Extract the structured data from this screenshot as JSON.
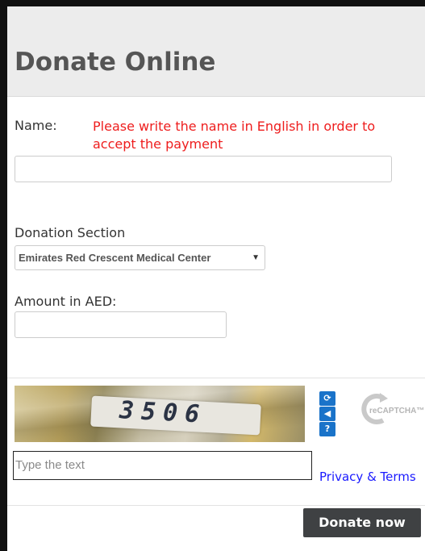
{
  "page": {
    "title": "Donate Online"
  },
  "form": {
    "name_label": "Name:",
    "name_note": "Please write the name in English in order to accept the payment",
    "name_value": "",
    "section_label": "Donation Section",
    "section_selected": "Emirates Red Crescent Medical Center",
    "amount_label": "Amount in AED:",
    "amount_value": ""
  },
  "captcha": {
    "challenge_text": "3506",
    "input_placeholder": "Type the text",
    "privacy_link": "Privacy & Terms",
    "brand": "reCAPTCHA™",
    "buttons": [
      "refresh-icon",
      "audio-icon",
      "help-icon"
    ]
  },
  "actions": {
    "donate_label": "Donate now"
  },
  "colors": {
    "header_bg": "#ececec",
    "note_red": "#ee1d1d",
    "button_bg": "#3f4143",
    "link_blue": "#1a1aff",
    "captcha_blue": "#1a73c9"
  }
}
